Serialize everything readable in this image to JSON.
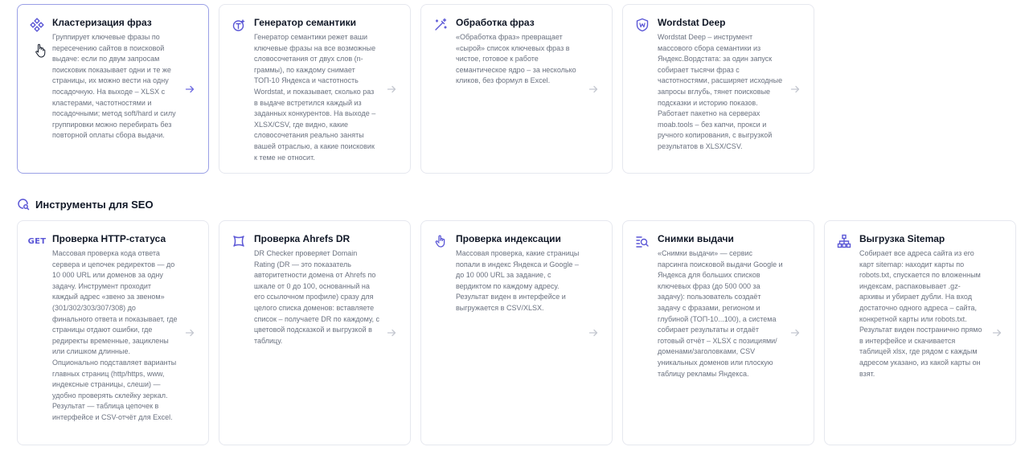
{
  "top_cards": [
    {
      "icon": "cluster-icon",
      "title": "Кластеризация фраз",
      "desc": "Группирует ключевые фразы по пересечению сайтов в поисковой выдаче: если по двум запросам поисковик показывает одни и те же страницы, их можно вести на одну посадочную. На выходе – XLSX с кластерами, частотностями и посадочными; метод soft/hard и силу группировки можно перебирать без повторной оплаты сбора выдачи."
    },
    {
      "icon": "semantic-generator-icon",
      "title": "Генератор семантики",
      "desc": "Генератор семантики режет ваши ключевые фразы на все возможные словосочетания от двух слов (n-граммы), по каждому снимает ТОП-10 Яндекса и частотность Wordstat, и показывает, сколько раз в выдаче встретился каждый из заданных конкурентов. На выходе – XLSX/CSV, где видно, какие словосочетания реально заняты вашей отраслью, а какие поисковик к теме не относит."
    },
    {
      "icon": "magic-wand-icon",
      "title": "Обработка фраз",
      "desc": "«Обработка фраз» превращает «сырой» список ключевых фраз в чистое, готовое к работе семантическое ядро – за несколько кликов, без формул в Excel."
    },
    {
      "icon": "wordstat-shield-icon",
      "title": "Wordstat Deep",
      "desc": "Wordstat Deep – инструмент массового сбора семантики из Яндекс.Вордстата: за один запуск собирает тысячи фраз с частотностями, расширяет исходные запросы вглубь, тянет поисковые подсказки и историю показов. Работает пакетно на серверах moab.tools – без капчи, прокси и ручного копирования, с выгрузкой результатов в XLSX/CSV."
    }
  ],
  "section": {
    "title": "Инструменты для SEO",
    "icon": "search-seo-icon"
  },
  "bottom_cards": [
    {
      "icon": "get-icon",
      "icon_text": "GET",
      "title": "Проверка HTTP-статуса",
      "desc": "Массовая проверка кода ответа сервера и цепочек редиректов — до 10 000 URL или доменов за одну задачу. Инструмент проходит каждый адрес «звено за звеном» (301/302/303/307/308) до финального ответа и показывает, где страницы отдают ошибки, где редиректы временные, зациклены или слишком длинные. Опционально подставляет варианты главных страниц (http/https, www, индексные страницы, слеши) — удобно проверять склейку зеркал. Результат — таблица цепочек в интерфейсе и CSV-отчёт для Excel."
    },
    {
      "icon": "ahrefs-dr-icon",
      "title": "Проверка Ahrefs DR",
      "desc": "DR Checker проверяет Domain Rating (DR — это показатель авторитетности домена от Ahrefs по шкале от 0 до 100, основанный на его ссылочном профиле) сразу для целого списка доменов: вставляете список – получаете DR по каждому, с цветовой подсказкой и выгрузкой в таблицу."
    },
    {
      "icon": "pointer-hand-icon",
      "title": "Проверка индексации",
      "desc": "Массовая проверка, какие страницы попали в индекс Яндекса и Google – до 10 000 URL за задание, с вердиктом по каждому адресу. Результат виден в интерфейсе и выгружается в CSV/XLSX."
    },
    {
      "icon": "serp-snapshot-icon",
      "title": "Снимки выдачи",
      "desc": "«Снимки выдачи» — сервис парсинга поисковой выдачи Google и Яндекса для больших списков ключевых фраз (до 500 000 за задачу): пользователь создаёт задачу с фразами, регионом и глубиной (ТОП-10...100), а система собирает результаты и отдаёт готовый отчёт – XLSX с позициями/доменами/заголовками, CSV уникальных доменов или плоскую таблицу рекламы Яндекса."
    },
    {
      "icon": "sitemap-icon",
      "title": "Выгрузка Sitemap",
      "desc": "Собирает все адреса сайта из его карт sitemap: находит карты по robots.txt, спускается по вложенным индексам, распаковывает .gz-архивы и убирает дубли. На вход достаточно одного адреса – сайта, конкретной карты или robots.txt. Результат виден постранично прямо в интерфейсе и скачивается таблицей xlsx, где рядом с каждым адресом указано, из какой карты он взят."
    }
  ],
  "colors": {
    "accent": "#5b57d6",
    "active_border": "#9aa0e6",
    "muted_text": "#6b7280"
  }
}
